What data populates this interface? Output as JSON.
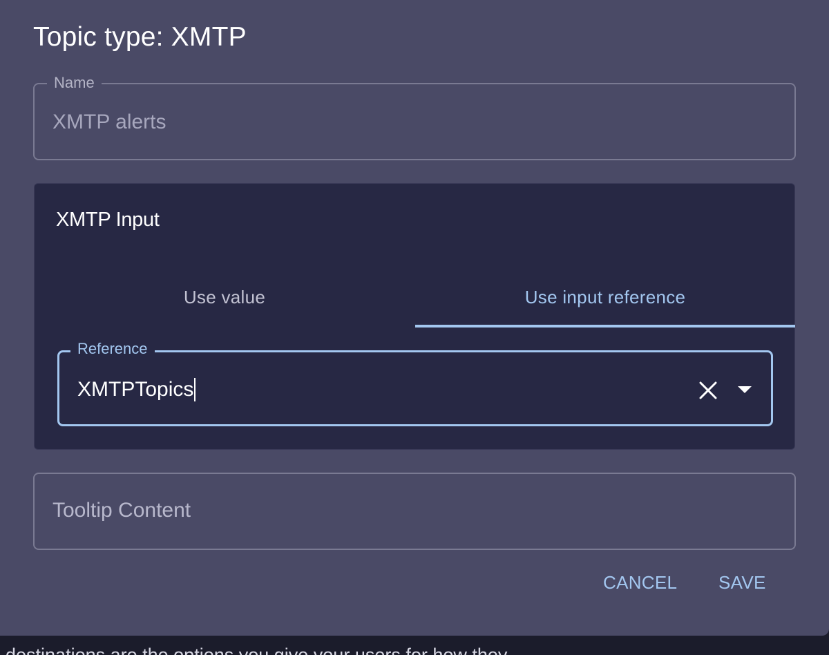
{
  "dialog": {
    "title": "Topic type: XMTP",
    "name_field": {
      "label": "Name",
      "placeholder": "XMTP alerts"
    },
    "panel": {
      "title": "XMTP Input",
      "tabs": [
        {
          "label": "Use value",
          "selected": false
        },
        {
          "label": "Use input reference",
          "selected": true
        }
      ],
      "reference_field": {
        "label": "Reference",
        "value": "XMTPTopics"
      }
    },
    "tooltip_field": {
      "placeholder": "Tooltip Content"
    },
    "actions": {
      "cancel_label": "CANCEL",
      "save_label": "SAVE"
    }
  },
  "background_text": "destinations are the options you give your users for how they",
  "colors": {
    "dialog_bg": "#4a4a66",
    "panel_bg": "#272844",
    "accent": "#a3c7f0"
  }
}
